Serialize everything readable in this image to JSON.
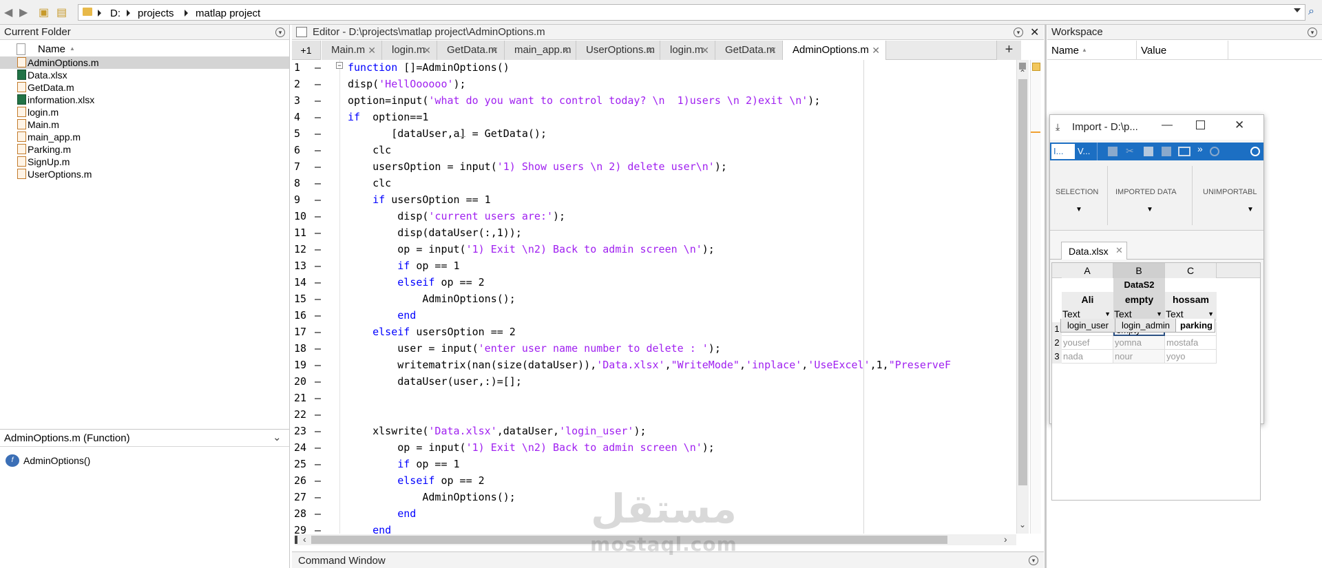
{
  "address_bar": {
    "crumbs": [
      "D:",
      "projects",
      "matlap project"
    ]
  },
  "current_folder": {
    "title": "Current Folder",
    "column_name": "Name",
    "sort_indicator": "▲",
    "files": [
      {
        "name": "AdminOptions.m",
        "type": "m",
        "selected": true
      },
      {
        "name": "Data.xlsx",
        "type": "xlsx"
      },
      {
        "name": "GetData.m",
        "type": "m"
      },
      {
        "name": "information.xlsx",
        "type": "xlsx"
      },
      {
        "name": "login.m",
        "type": "m"
      },
      {
        "name": "Main.m",
        "type": "m"
      },
      {
        "name": "main_app.m",
        "type": "m"
      },
      {
        "name": "Parking.m",
        "type": "m"
      },
      {
        "name": "SignUp.m",
        "type": "m"
      },
      {
        "name": "UserOptions.m",
        "type": "m"
      }
    ]
  },
  "details": {
    "title": "AdminOptions.m  (Function)",
    "item": "AdminOptions()"
  },
  "editor": {
    "title": "Editor - D:\\projects\\matlap project\\AdminOptions.m",
    "overflow_label": "+1",
    "tabs": [
      "Main.m",
      "login.m",
      "GetData.m",
      "main_app.m",
      "UserOptions.m",
      "login.m",
      "GetData.m",
      "AdminOptions.m"
    ],
    "active_tab": 7,
    "add_tab_label": "+",
    "lines": [
      {
        "n": "1",
        "segs": [
          [
            "kw",
            "function"
          ],
          [
            "p",
            " []=AdminOptions()"
          ]
        ]
      },
      {
        "n": "2",
        "segs": [
          [
            "p",
            "disp("
          ],
          [
            "str",
            "'HellOooooo'"
          ],
          [
            "p",
            ");"
          ]
        ]
      },
      {
        "n": "3",
        "segs": [
          [
            "p",
            "option=input("
          ],
          [
            "str",
            "'what do you want to control today? \\n  1)users \\n 2)exit \\n'"
          ],
          [
            "p",
            ");"
          ]
        ]
      },
      {
        "n": "4",
        "segs": [
          [
            "kw",
            "if"
          ],
          [
            "p",
            "  option==1"
          ]
        ]
      },
      {
        "n": "5",
        "segs": [
          [
            "p",
            "       [dataUser,a] = GetData();"
          ]
        ]
      },
      {
        "n": "6",
        "segs": [
          [
            "p",
            "    clc"
          ]
        ]
      },
      {
        "n": "7",
        "segs": [
          [
            "p",
            "    usersOption = input("
          ],
          [
            "str",
            "'1) Show users \\n 2) delete user\\n'"
          ],
          [
            "p",
            ");"
          ]
        ]
      },
      {
        "n": "8",
        "segs": [
          [
            "p",
            "    clc"
          ]
        ]
      },
      {
        "n": "9",
        "segs": [
          [
            "p",
            "    "
          ],
          [
            "kw",
            "if"
          ],
          [
            "p",
            " usersOption == 1"
          ]
        ]
      },
      {
        "n": "10",
        "segs": [
          [
            "p",
            "        disp("
          ],
          [
            "str",
            "'current users are:'"
          ],
          [
            "p",
            ");"
          ]
        ]
      },
      {
        "n": "11",
        "segs": [
          [
            "p",
            "        disp(dataUser(:,1));"
          ]
        ]
      },
      {
        "n": "12",
        "segs": [
          [
            "p",
            "        op = input("
          ],
          [
            "str",
            "'1) Exit \\n2) Back to admin screen \\n'"
          ],
          [
            "p",
            ");"
          ]
        ]
      },
      {
        "n": "13",
        "segs": [
          [
            "p",
            "        "
          ],
          [
            "kw",
            "if"
          ],
          [
            "p",
            " op == 1"
          ]
        ]
      },
      {
        "n": "14",
        "segs": [
          [
            "p",
            "        "
          ],
          [
            "kw",
            "elseif"
          ],
          [
            "p",
            " op == 2"
          ]
        ]
      },
      {
        "n": "15",
        "segs": [
          [
            "p",
            "            AdminOptions();"
          ]
        ]
      },
      {
        "n": "16",
        "segs": [
          [
            "p",
            "        "
          ],
          [
            "kw",
            "end"
          ]
        ]
      },
      {
        "n": "17",
        "segs": [
          [
            "p",
            "    "
          ],
          [
            "kw",
            "elseif"
          ],
          [
            "p",
            " usersOption == 2"
          ]
        ]
      },
      {
        "n": "18",
        "segs": [
          [
            "p",
            "        user = input("
          ],
          [
            "str",
            "'enter user name number to delete : '"
          ],
          [
            "p",
            ");"
          ]
        ]
      },
      {
        "n": "19",
        "segs": [
          [
            "p",
            "        writematrix(nan(size(dataUser)),"
          ],
          [
            "str",
            "'Data.xlsx'"
          ],
          [
            "p",
            ","
          ],
          [
            "str",
            "\"WriteMode\""
          ],
          [
            "p",
            ","
          ],
          [
            "str",
            "'inplace'"
          ],
          [
            "p",
            ","
          ],
          [
            "str",
            "'UseExcel'"
          ],
          [
            "p",
            ",1,"
          ],
          [
            "str",
            "\"PreserveF"
          ]
        ]
      },
      {
        "n": "20",
        "segs": [
          [
            "p",
            "        dataUser(user,:)=[];"
          ]
        ]
      },
      {
        "n": "21",
        "segs": []
      },
      {
        "n": "22",
        "segs": []
      },
      {
        "n": "23",
        "segs": [
          [
            "p",
            "    xlswrite("
          ],
          [
            "str",
            "'Data.xlsx'"
          ],
          [
            "p",
            ",dataUser,"
          ],
          [
            "str",
            "'login_user'"
          ],
          [
            "p",
            ");"
          ]
        ]
      },
      {
        "n": "24",
        "segs": [
          [
            "p",
            "        op = input("
          ],
          [
            "str",
            "'1) Exit \\n2) Back to admin screen \\n'"
          ],
          [
            "p",
            ");"
          ]
        ]
      },
      {
        "n": "25",
        "segs": [
          [
            "p",
            "        "
          ],
          [
            "kw",
            "if"
          ],
          [
            "p",
            " op == 1"
          ]
        ]
      },
      {
        "n": "26",
        "segs": [
          [
            "p",
            "        "
          ],
          [
            "kw",
            "elseif"
          ],
          [
            "p",
            " op == 2"
          ]
        ]
      },
      {
        "n": "27",
        "segs": [
          [
            "p",
            "            AdminOptions();"
          ]
        ]
      },
      {
        "n": "28",
        "segs": [
          [
            "p",
            "        "
          ],
          [
            "kw",
            "end"
          ]
        ]
      },
      {
        "n": "29",
        "segs": [
          [
            "p",
            "    "
          ],
          [
            "kw",
            "end"
          ]
        ]
      }
    ]
  },
  "command_window": {
    "title": "Command Window"
  },
  "workspace": {
    "title": "Workspace",
    "col_name": "Name",
    "col_value": "Value",
    "sort_indicator": "▲"
  },
  "import": {
    "title": "Import - D:\\p...",
    "toolstrip_tabs": [
      "I...",
      "V..."
    ],
    "more": "»",
    "sections": [
      "SELECTION",
      "IMPORTED DATA",
      "UNIMPORTABL"
    ],
    "file_tab": "Data.xlsx",
    "columns": [
      "A",
      "B",
      "C"
    ],
    "range_name": "DataS2",
    "var_names": [
      "Ali",
      "empty",
      "hossam"
    ],
    "types": [
      "Text",
      "Text",
      "Text"
    ],
    "rows": [
      {
        "n": "1",
        "cells": [
          "Ali",
          "empty",
          "hossam"
        ]
      },
      {
        "n": "2",
        "cells": [
          "yousef",
          "yomna",
          "mostafa"
        ]
      },
      {
        "n": "3",
        "cells": [
          "nada",
          "nour",
          "yoyo"
        ]
      }
    ],
    "sheets": [
      "login_user",
      "login_admin",
      "parking"
    ],
    "active_sheet": 2
  },
  "watermark": {
    "arabic": "مستقل",
    "latin": "mostaql.com"
  },
  "colors": {
    "keyword": "#0000ff",
    "string": "#a020f0",
    "import_blue": "#1c6fc3",
    "selected_row": "#d4d4d4"
  }
}
